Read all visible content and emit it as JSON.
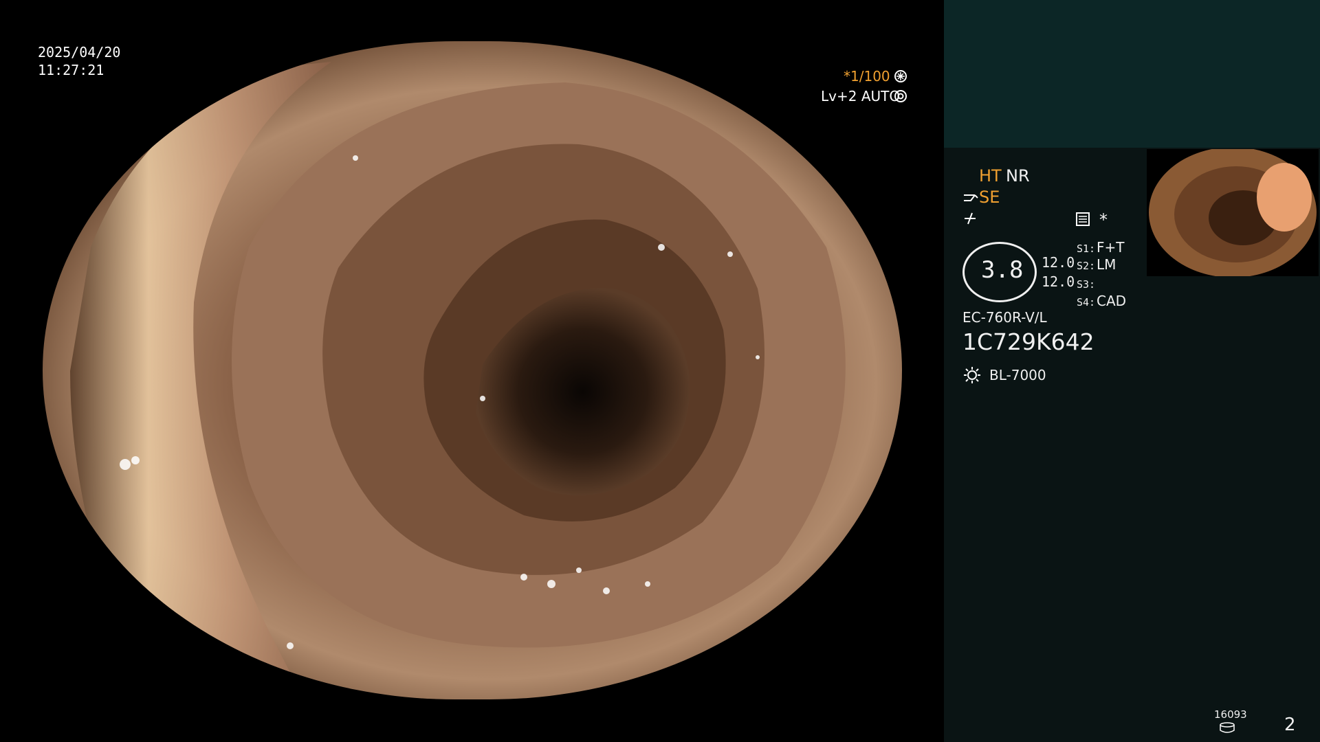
{
  "overlay": {
    "date": "2025/04/20",
    "time": "11:27:21",
    "shutter": "*1/100",
    "level": "Lv+2 AUTO"
  },
  "panel": {
    "ht_label": "HT",
    "nr_label": "NR",
    "se_label": "SE",
    "asterisk": "*",
    "magnification": "3.8",
    "val1": "12.0",
    "val2": "12.0",
    "s1_label": "S1:",
    "s1_value": "F+T",
    "s2_label": "S2:",
    "s2_value": "LM",
    "s3_label": "S3:",
    "s3_value": "",
    "s4_label": "S4:",
    "s4_value": "CAD",
    "scope_model": "EC-760R-V/L",
    "serial": "1C729K642",
    "light_source": "BL-7000",
    "count": "16093",
    "page": "2"
  },
  "icons": [
    "shutter-dial-icon",
    "settings-dial-icon",
    "scope-tip-icon",
    "flash-icon",
    "list-icon",
    "sun-icon",
    "storage-icon"
  ],
  "colors": {
    "accent": "#f0a030",
    "panel_bg": "#0a1414",
    "panel_top": "#0c2626"
  }
}
